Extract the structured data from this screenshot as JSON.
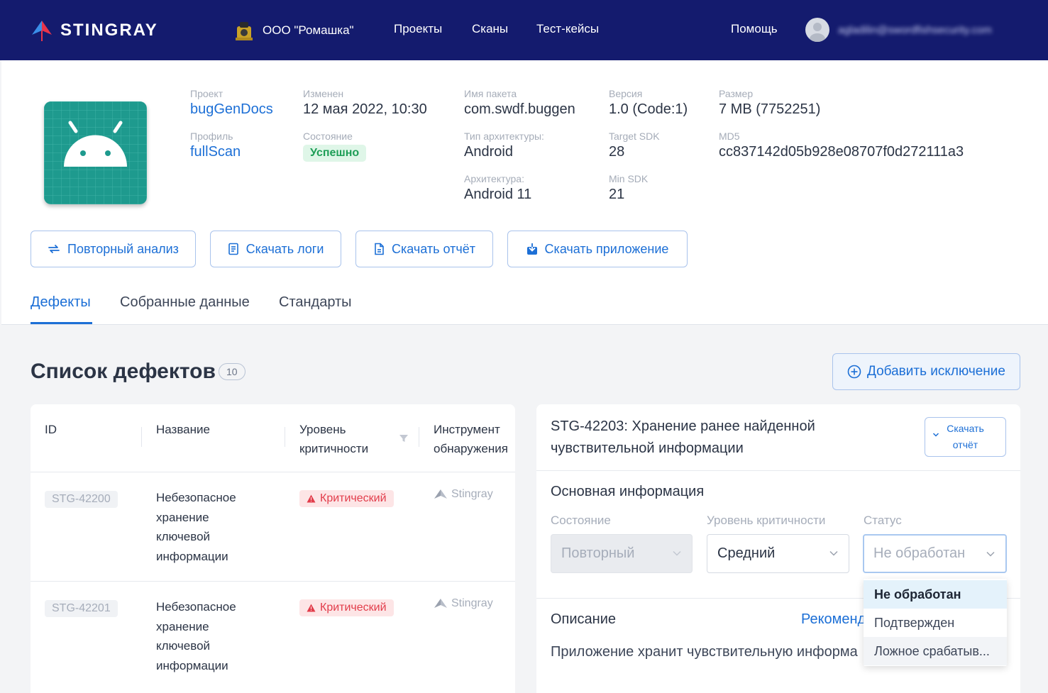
{
  "nav": {
    "brand": "STINGRAY",
    "org": "ООО \"Ромашка\"",
    "links": [
      "Проекты",
      "Сканы",
      "Тест-кейсы"
    ],
    "help": "Помощь",
    "email": "agladilin@swordfishsecurity.com"
  },
  "scan": {
    "project_label": "Проект",
    "project": "bugGenDocs",
    "profile_label": "Профиль",
    "profile": "fullScan",
    "modified_label": "Изменен",
    "modified": "12 мая 2022, 10:30",
    "state_label": "Состояние",
    "state": "Успешно",
    "package_label": "Имя пакета",
    "package": "com.swdf.buggen",
    "arch_type_label": "Тип архитектуры:",
    "arch_type": "Android",
    "arch_label": "Архитектура:",
    "arch": "Android 11",
    "version_label": "Версия",
    "version": "1.0 (Code:1)",
    "target_sdk_label": "Target SDK",
    "target_sdk": "28",
    "min_sdk_label": "Min SDK",
    "min_sdk": "21",
    "size_label": "Размер",
    "size": "7 MB (7752251)",
    "md5_label": "MD5",
    "md5": "cc837142d05b928e08707f0d272111a3"
  },
  "actions": {
    "reanalyze": "Повторный анализ",
    "download_logs": "Скачать логи",
    "download_report": "Скачать отчёт",
    "download_app": "Скачать приложение"
  },
  "tabs": [
    "Дефекты",
    "Собранные данные",
    "Стандарты"
  ],
  "defects": {
    "title": "Список дефектов",
    "count": "10",
    "add_exception": "Добавить исключение",
    "columns": {
      "id": "ID",
      "name": "Название",
      "severity_1": "Уровень",
      "severity_2": "критичности",
      "tool_1": "Инструмент",
      "tool_2": "обнаружения"
    },
    "rows": [
      {
        "id": "STG-42200",
        "name_lines": [
          "Небезопасное",
          "хранение",
          "ключевой",
          "информации"
        ],
        "severity": "Критический",
        "tool": "Stingray"
      },
      {
        "id": "STG-42201",
        "name_lines": [
          "Небезопасное",
          "хранение",
          "ключевой",
          "информации"
        ],
        "severity": "Критический",
        "tool": "Stingray"
      }
    ]
  },
  "detail": {
    "title_1": "STG-42203: Хранение ранее найденной",
    "title_2": "чувствительной информации",
    "download_1": "Скачать",
    "download_2": "отчёт",
    "basic_info": "Основная информация",
    "state_label": "Состояние",
    "state_value": "Повторный",
    "severity_label": "Уровень критичности",
    "severity_value": "Средний",
    "status_label": "Статус",
    "status_value": "Не обработан",
    "description_title": "Описание",
    "recommendations": "Рекоменд",
    "description_text": "Приложение хранит чувствительную информа"
  },
  "status_dropdown": {
    "options": [
      "Не обработан",
      "Подтвержден",
      "Ложное срабатыв..."
    ]
  }
}
